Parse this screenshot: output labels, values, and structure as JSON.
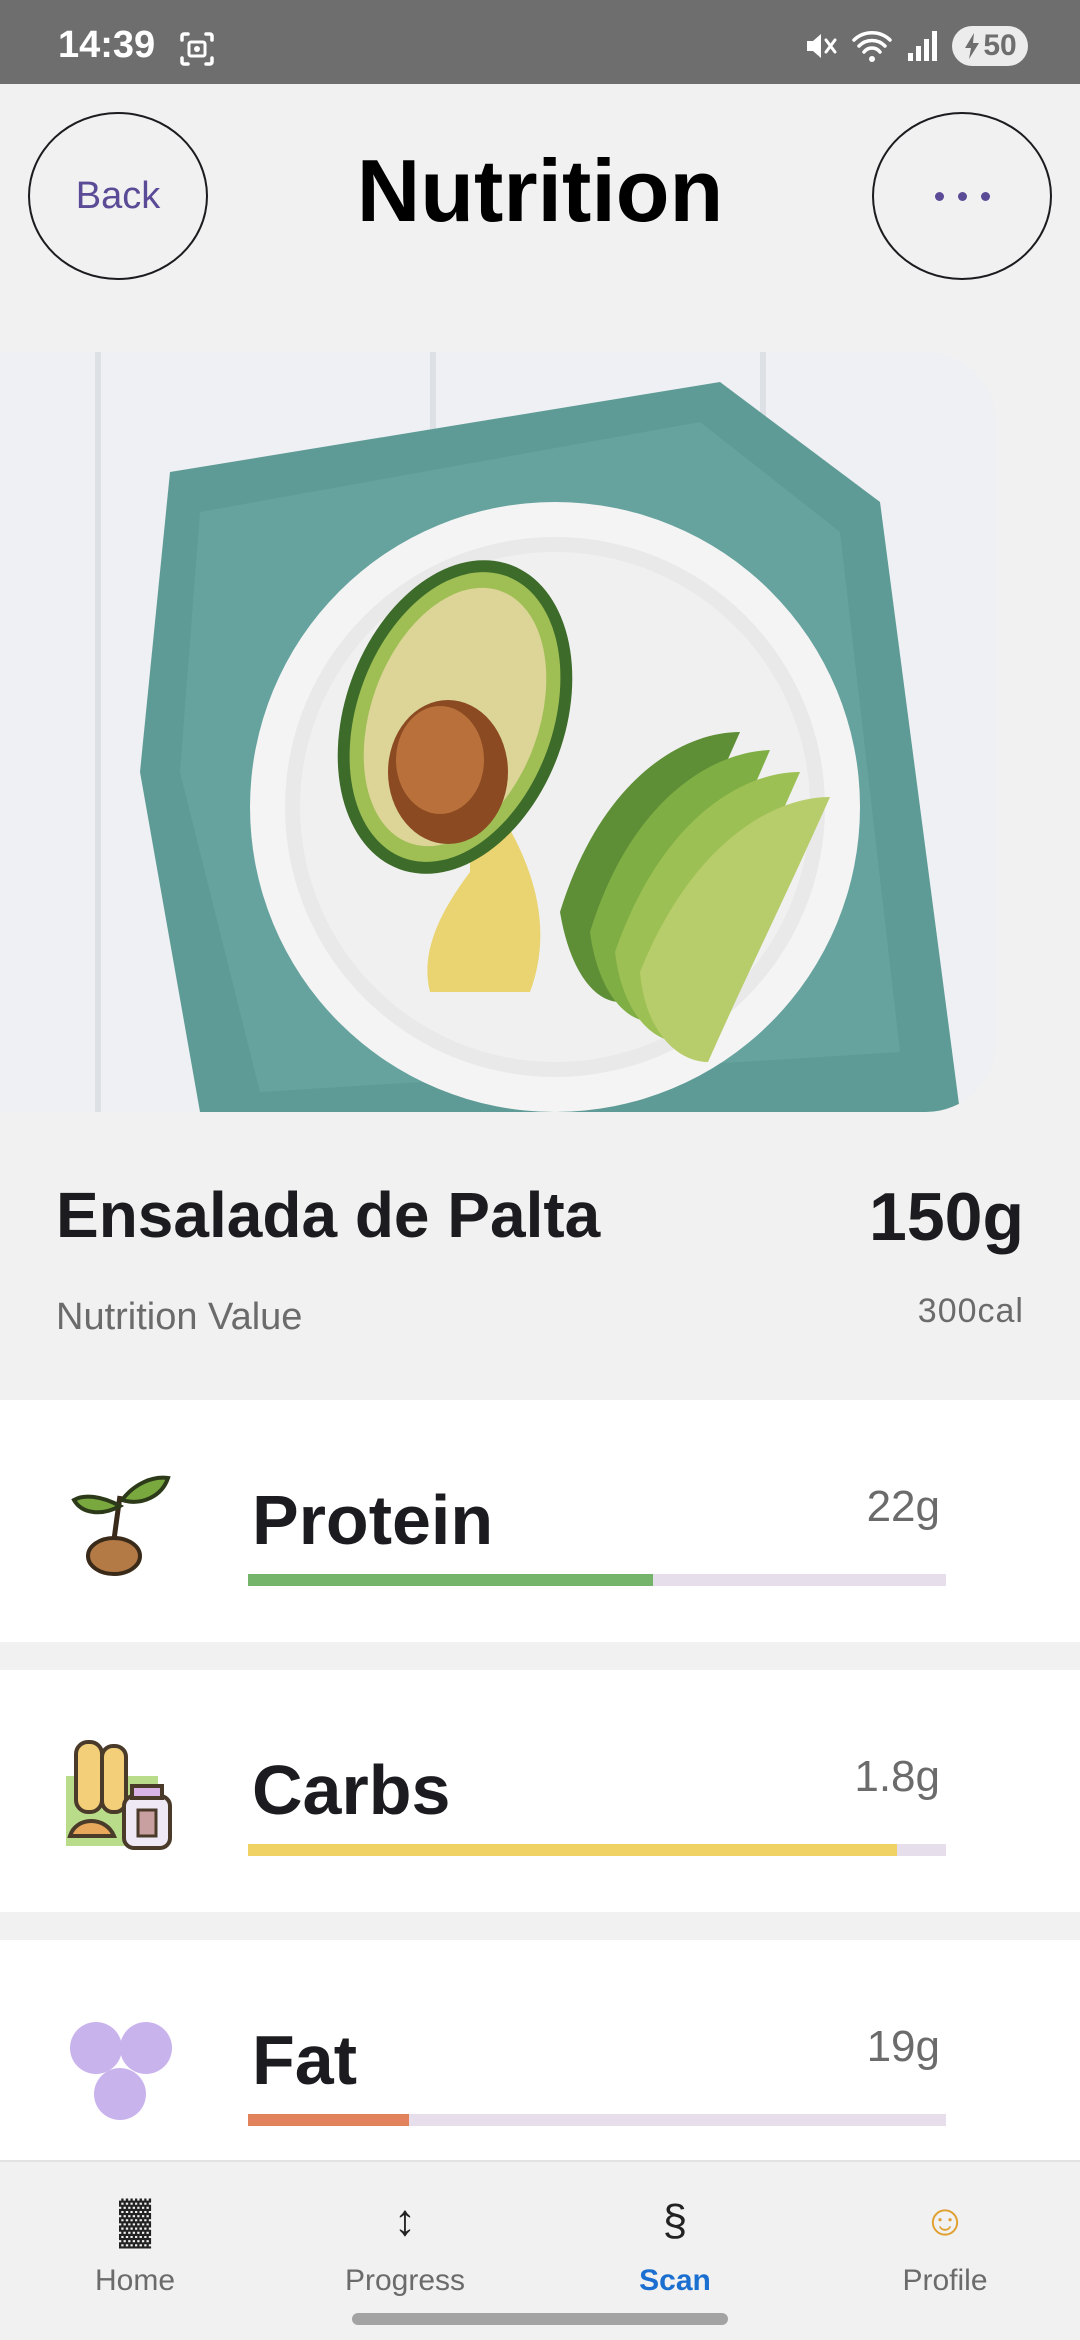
{
  "status_bar": {
    "time": "14:39",
    "battery": "50"
  },
  "header": {
    "back_label": "Back",
    "title": "Nutrition"
  },
  "food": {
    "name": "Ensalada de Palta",
    "weight": "150g",
    "nutrition_label": "Nutrition Value",
    "calories": "300cal"
  },
  "nutrients": [
    {
      "name": "Protein",
      "amount": "22g",
      "progress": 0.58,
      "color": "#73b36a"
    },
    {
      "name": "Carbs",
      "amount": "1.8g",
      "progress": 0.93,
      "color": "#f0d264"
    },
    {
      "name": "Fat",
      "amount": "19g",
      "progress": 0.23,
      "color": "#e2825a"
    }
  ],
  "nav": [
    {
      "label": "Home",
      "icon": "▓"
    },
    {
      "label": "Progress",
      "icon": "↕"
    },
    {
      "label": "Scan",
      "icon": "§"
    },
    {
      "label": "Profile",
      "icon": "☺"
    }
  ],
  "colors": {
    "accent": "#5b4a96",
    "active_nav": "#1a6fd0"
  }
}
